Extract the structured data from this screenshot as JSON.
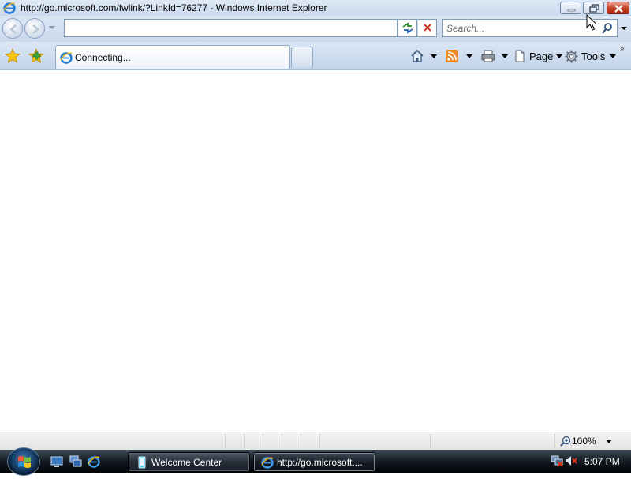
{
  "window": {
    "title": "http://go.microsoft.com/fwlink/?LinkId=76277 - Windows Internet Explorer"
  },
  "address_bar": {
    "value": ""
  },
  "search": {
    "placeholder": "Search..."
  },
  "tabs": [
    {
      "label": "Connecting...",
      "active": true
    }
  ],
  "command_bar": {
    "page_label": "Page",
    "tools_label": "Tools"
  },
  "status_bar": {
    "zoom": "100%"
  },
  "taskbar": {
    "buttons": [
      {
        "label": "Welcome Center",
        "icon": "welcome-center-icon",
        "active": false
      },
      {
        "label": "http://go.microsoft....",
        "icon": "ie-icon",
        "active": true
      }
    ],
    "clock": "5:07 PM"
  },
  "colors": {
    "chrome_top": "#dbe6f4",
    "chrome_bottom": "#c2d4ea",
    "taskbar": "#161d25",
    "close_button": "#c5432b"
  }
}
